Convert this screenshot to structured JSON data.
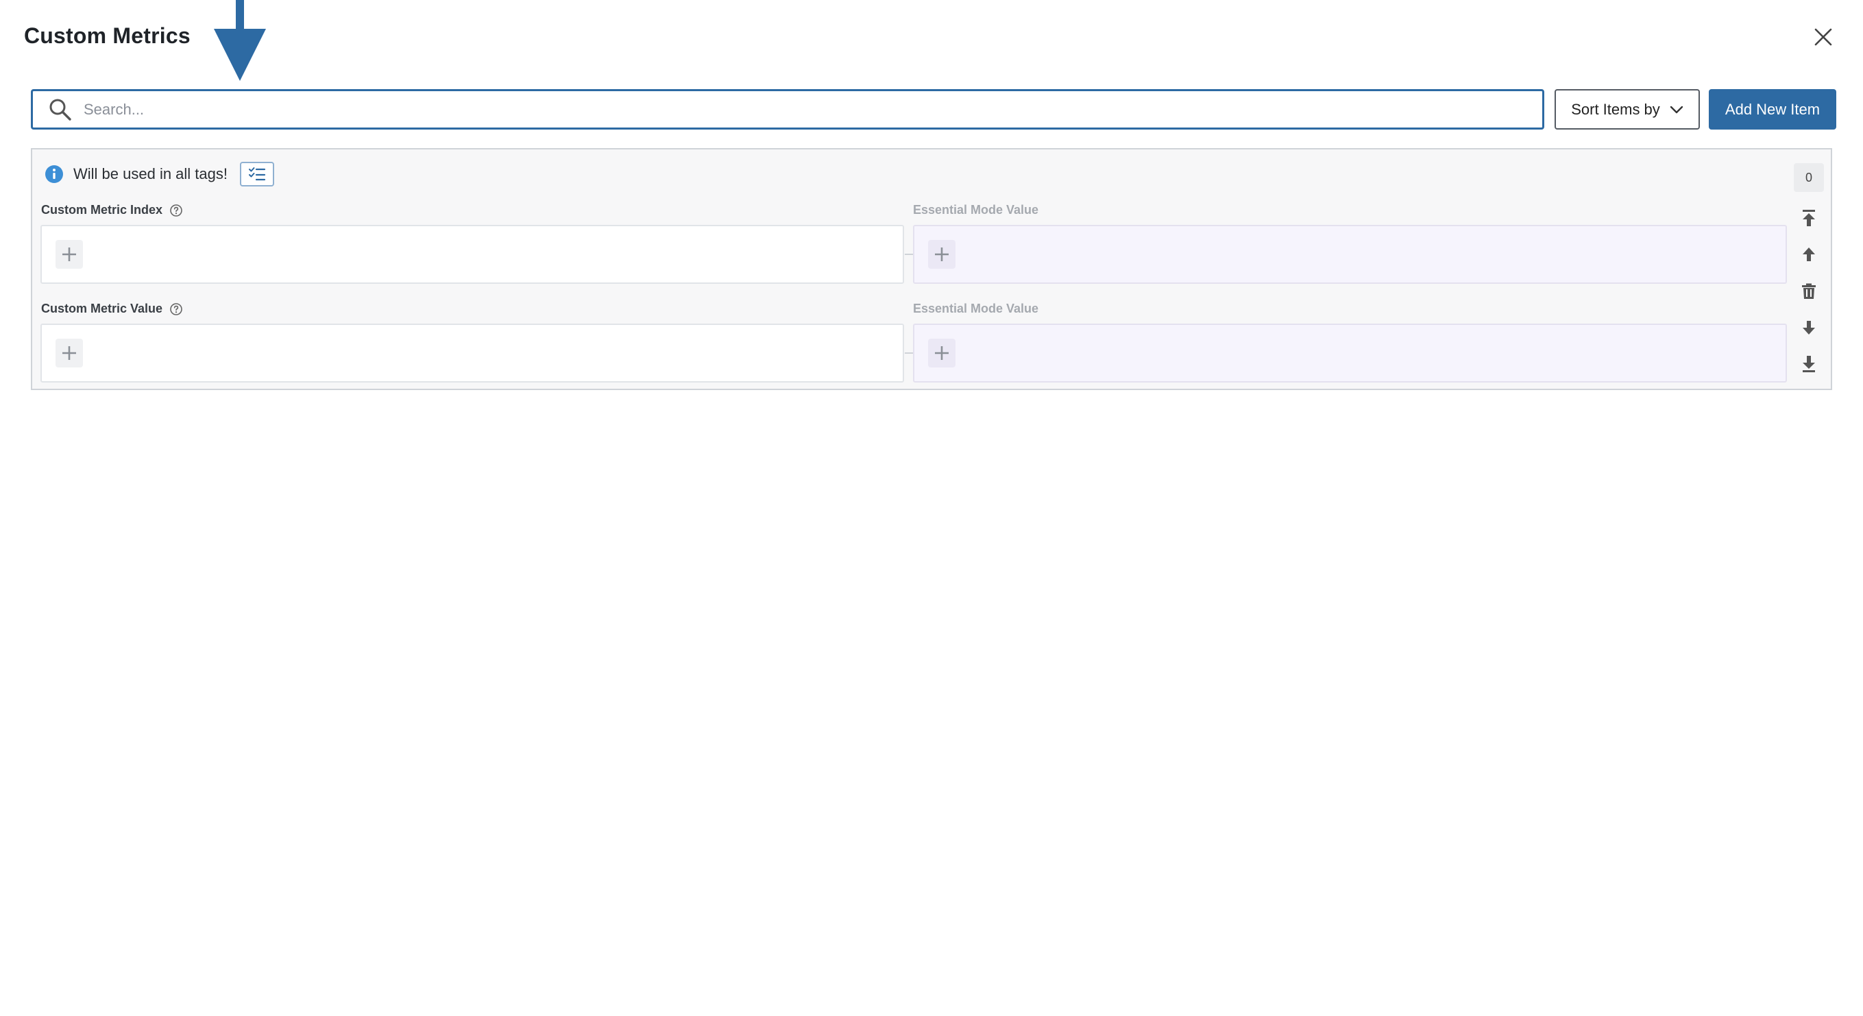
{
  "dialog": {
    "title": "Custom Metrics",
    "close_icon": "close-icon"
  },
  "toolbar": {
    "search_placeholder": "Search...",
    "search_value": "",
    "sort_label": "Sort Items by",
    "add_label": "Add New Item"
  },
  "item": {
    "info_text": "Will be used in all tags!",
    "counter": "0",
    "fields": [
      {
        "label": "Custom Metric Index",
        "essential_label": "Essential Mode Value"
      },
      {
        "label": "Custom Metric Value",
        "essential_label": "Essential Mode Value"
      }
    ]
  },
  "colors": {
    "accent": "#2d6aa3",
    "essential_bg": "#f6f4fd",
    "card_bg": "#f7f7f8",
    "info_icon": "#3d8fd6"
  },
  "icons": {
    "search": "search-icon",
    "chevron": "chevron-down-icon",
    "info": "info-icon",
    "list": "checklist-icon",
    "help": "help-circle-icon",
    "plus": "plus-icon",
    "move_top": "move-to-top-icon",
    "move_up": "arrow-up-icon",
    "delete": "trash-icon",
    "move_down": "arrow-down-icon",
    "move_bottom": "move-to-bottom-icon"
  }
}
